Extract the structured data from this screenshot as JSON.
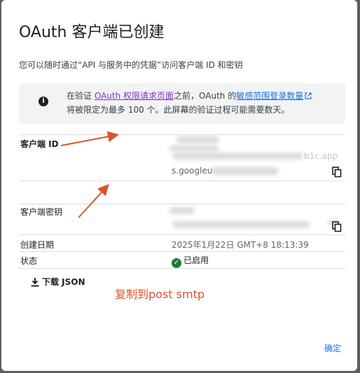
{
  "dialog": {
    "title": "OAuth 客户端已创建",
    "subtitle": "您可以随时通过“API 与服务中的凭据”访问客户端 ID 和密钥",
    "notice": {
      "part1": "在验证 ",
      "link1": "OAuth 权限请求页面",
      "part2": "之前，OAuth 的",
      "link2": "敏感范围登录数量",
      "part3": "将被限定为最多 100 个。此屏幕的验证过程可能需要数天。"
    },
    "client_id": {
      "label": "客户端 ID",
      "value_fragment_1": "b1c.app",
      "value_fragment_2": "s.googleu"
    },
    "client_secret": {
      "label": "客户端密钥"
    },
    "created_date": {
      "label": "创建日期",
      "value": "2025年1月22日 GMT+8 18:13:39"
    },
    "status": {
      "label": "状态",
      "value": "已启用"
    },
    "download_label": "下载 JSON",
    "ok_label": "确定"
  },
  "annotation": {
    "text": "复制到post smtp",
    "color": "#d9542b"
  },
  "icons": {
    "info": "info-icon",
    "external": "external-link-icon",
    "copy": "copy-icon",
    "check": "check-circle-icon",
    "download": "download-icon"
  }
}
